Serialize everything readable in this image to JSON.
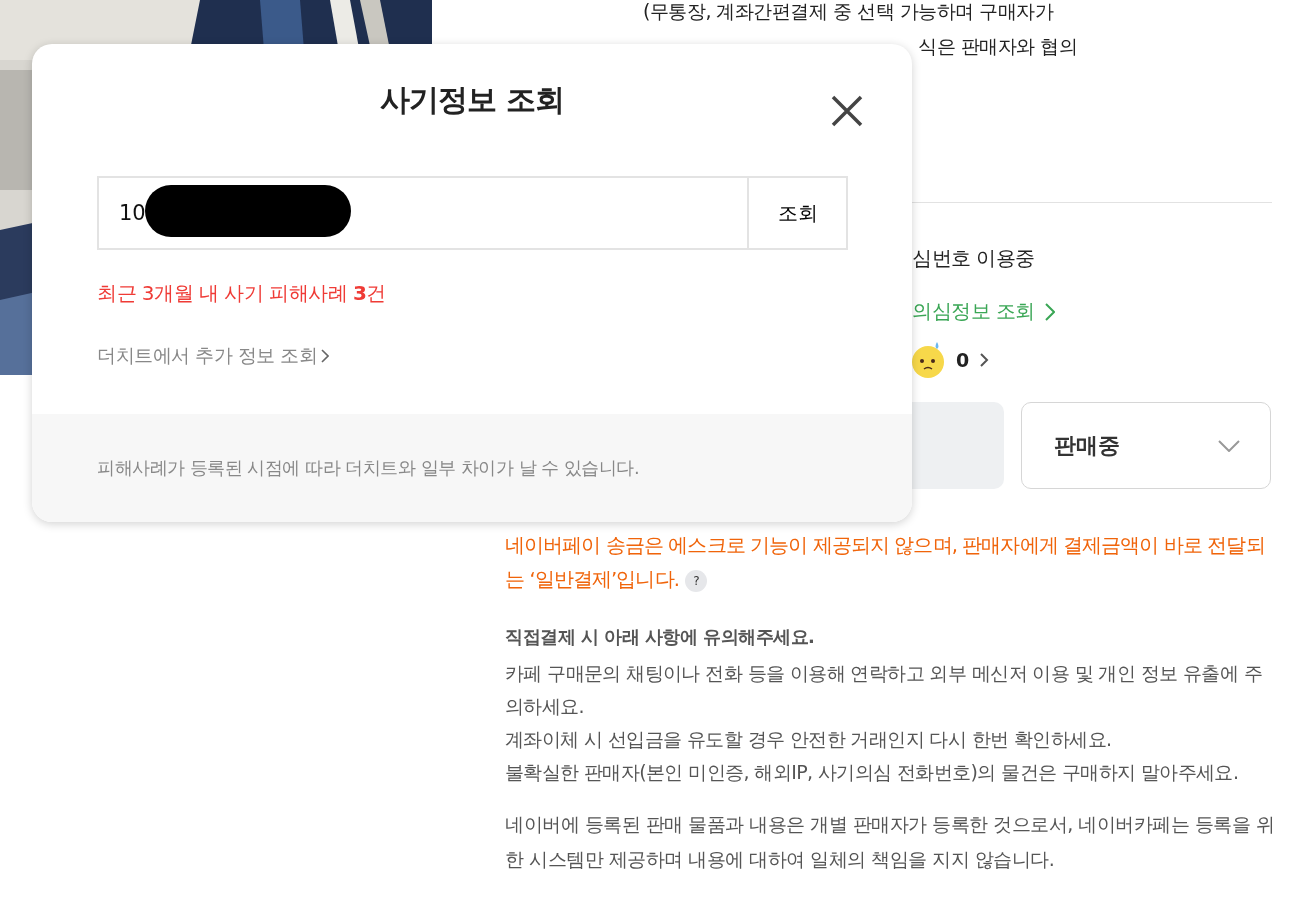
{
  "listing": {
    "payment_note_line": "(무통장, 계좌간편결제 중 선택 가능하며 구매자가",
    "payment_note_partial": "식은 판매자와 협의",
    "phone_status": "심번호 이용중",
    "suspicion_link": "의심정보 조회",
    "reaction_count": "0",
    "sale_status": "판매중",
    "escrow_warning": "네이버페이 송금은 에스크로 기능이 제공되지 않으며, 판매자에게 결제금액이 바로 전달되는 ‘일반결제’입니다.",
    "help_mark": "?",
    "caution_title": "직접결제 시 아래 사항에 유의해주세요.",
    "cautions": [
      "카페 구매문의 채팅이나 전화 등을 이용해 연락하고 외부 메신저 이용 및 개인 정보 유출에 주의하세요.",
      "계좌이체 시 선입금을 유도할 경우 안전한 거래인지 다시 한번 확인하세요.",
      "불확실한 판매자(본인 미인증, 해외IP, 사기의심 전화번호)의 물건은 구매하지 말아주세요."
    ],
    "disclaimer": "네이버에 등록된 판매 물품과 내용은 개별 판매자가 등록한 것으로서, 네이버카페는 등록을 위한 시스템만 제공하며 내용에 대하여 일체의 책임을 지지 않습니다."
  },
  "dialog": {
    "title": "사기정보 조회",
    "search": {
      "value": "10",
      "redacted": true
    },
    "search_button": "조회",
    "result": "최근 3개월 내 사기 피해사례 **3**건",
    "more_link": "더치트에서 추가 정보 조회",
    "footer_note": "피해사례가 등록된 시점에 따라 더치트와 일부 차이가 날 수 있습니다."
  }
}
